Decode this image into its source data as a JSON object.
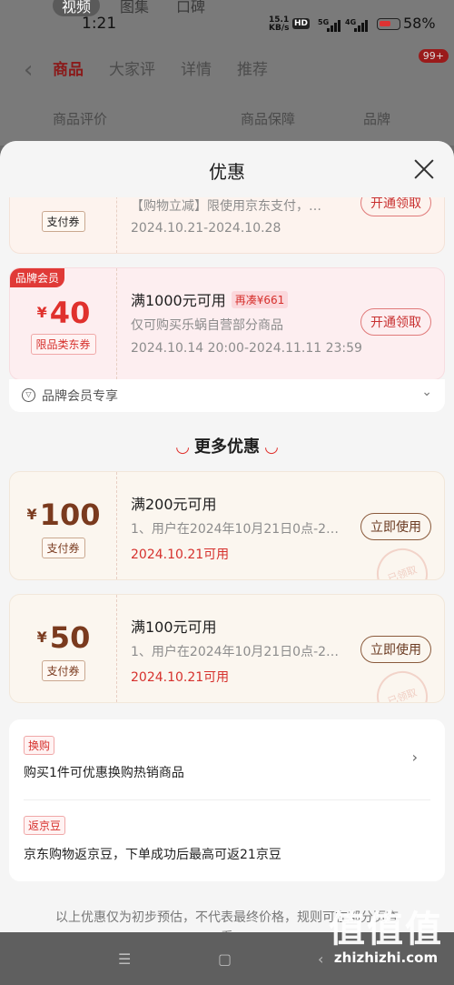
{
  "background": {
    "top_tabs": [
      "视频",
      "图集",
      "口碑"
    ],
    "nav_tabs": [
      "商品",
      "大家评",
      "详情",
      "推荐"
    ],
    "message_badge": "99+",
    "row_items": [
      "商品评价",
      "商品保障",
      "品牌"
    ]
  },
  "status_bar": {
    "time": "1:21",
    "net_speed_top": "15.1",
    "net_speed_unit": "KB/s",
    "hd": "HD",
    "sig5": "5G",
    "sig4": "4G",
    "battery": "58%"
  },
  "sheet": {
    "title": "优惠"
  },
  "coupons": [
    {
      "amount": "",
      "tag": "支付券",
      "title": "",
      "desc": "【购物立减】限使用京东支付，…",
      "date": "2024.10.21-2024.10.28",
      "button": "开通领取"
    },
    {
      "badge": "品牌会员",
      "yen": "¥",
      "amount": "40",
      "tag": "限品类东券",
      "title": "满1000元可用",
      "addup": "再凑¥661",
      "desc": "仅可购买乐蜗自营部分商品",
      "date": "2024.10.14 20:00-2024.11.11 23:59",
      "button": "开通领取"
    },
    {
      "yen": "¥",
      "amount": "100",
      "tag": "支付券",
      "title": "满200元可用",
      "desc": "1、用户在2024年10月21日0点-2…",
      "date": "2024.10.21可用",
      "button": "立即使用",
      "stamp": "已领取"
    },
    {
      "yen": "¥",
      "amount": "50",
      "tag": "支付券",
      "title": "满100元可用",
      "desc": "1、用户在2024年10月21日0点-2…",
      "date": "2024.10.21可用",
      "button": "立即使用",
      "stamp": "已领取"
    }
  ],
  "brand_strip": {
    "label": "品牌会员专享"
  },
  "more_section": {
    "title": "更多优惠"
  },
  "extras": [
    {
      "tag": "换购",
      "text": "购买1件可优惠换购热销商品"
    },
    {
      "tag": "返京豆",
      "text": "京东购物返京豆，下单成功后最高可返21京豆"
    }
  ],
  "footer_note": "以上优惠仅为初步预估，不代表最终价格，规则可在部分页查看",
  "watermark": {
    "logo": "值值值",
    "url": "zhizhizhi.com"
  },
  "colors": {
    "accent_red": "#d6312d",
    "brown": "#6b3b22",
    "sheet_bg": "#f5f5f5"
  }
}
